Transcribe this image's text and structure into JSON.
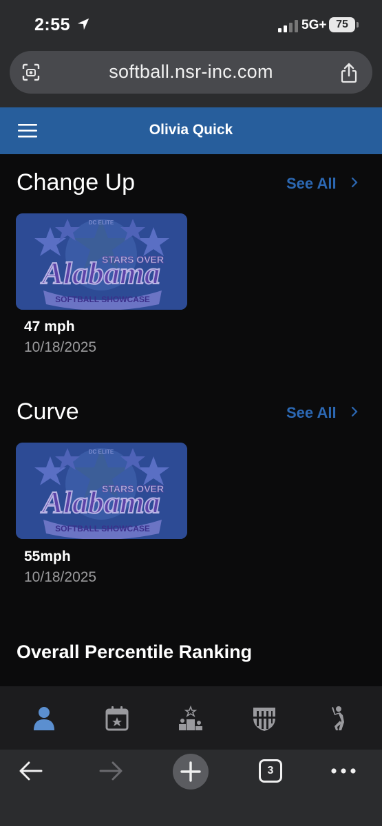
{
  "status_bar": {
    "time": "2:55",
    "network": "5G+",
    "battery": "75"
  },
  "browser": {
    "url": "softball.nsr-inc.com",
    "tabs_count": "3"
  },
  "header": {
    "title": "Olivia Quick"
  },
  "sections": [
    {
      "title": "Change Up",
      "see_all": "See All",
      "card": {
        "speed": "47 mph",
        "date": "10/18/2025",
        "image_alt": "Stars Over Alabama Softball Showcase"
      }
    },
    {
      "title": "Curve",
      "see_all": "See All",
      "card": {
        "speed": "55mph",
        "date": "10/18/2025",
        "image_alt": "Stars Over Alabama Softball Showcase"
      }
    }
  ],
  "percentile": {
    "title": "Overall Percentile Ranking"
  },
  "logo_text": {
    "top": "DC ELITE",
    "mid": "STARS OVER",
    "main": "Alabama",
    "bottom": "SOFTBALL SHOWCASE"
  },
  "tabs": [
    {
      "name": "profile",
      "active": true
    },
    {
      "name": "calendar",
      "active": false
    },
    {
      "name": "rankings",
      "active": false
    },
    {
      "name": "team",
      "active": false
    },
    {
      "name": "pitching",
      "active": false
    }
  ],
  "colors": {
    "header": "#275e9c",
    "link": "#2c68b3",
    "active_tab": "#5b8fd0",
    "inactive_tab": "#9a9a9e"
  }
}
